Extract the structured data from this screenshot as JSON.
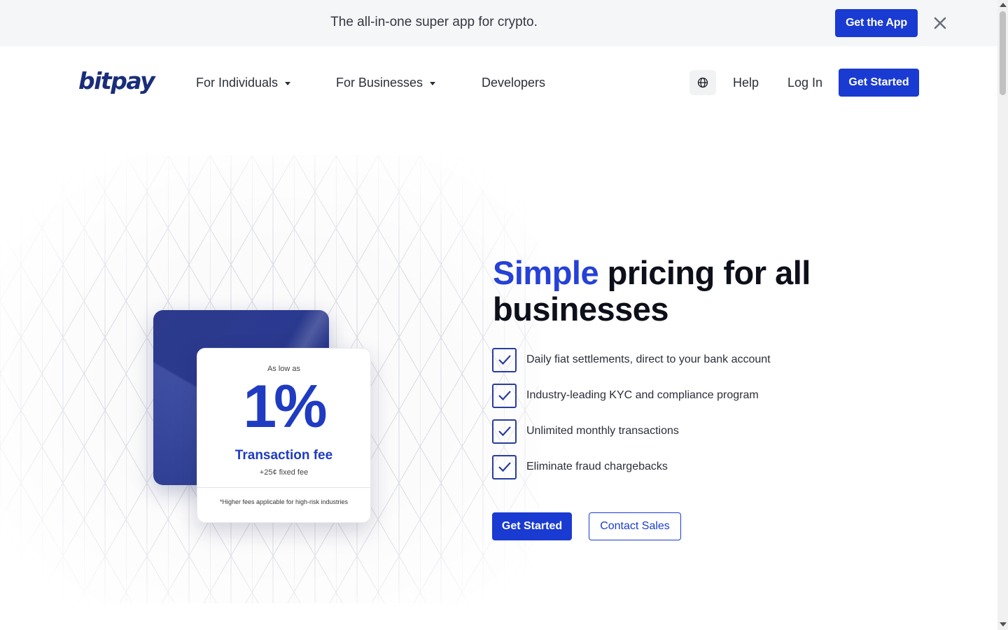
{
  "promo": {
    "text": "The all-in-one super app for crypto.",
    "cta_label": "Get the App",
    "close_icon": "close-icon"
  },
  "nav": {
    "logo": "bitpay",
    "items": [
      {
        "label": "For Individuals",
        "has_dropdown": true
      },
      {
        "label": "For Businesses",
        "has_dropdown": true
      },
      {
        "label": "Developers",
        "has_dropdown": false
      }
    ],
    "language_icon": "globe-icon",
    "help_label": "Help",
    "login_label": "Log In",
    "cta_label": "Get Started"
  },
  "hero": {
    "title_accent": "Simple",
    "title_rest": " pricing for all businesses",
    "card": {
      "eyebrow": "As low as",
      "rate": "1%",
      "title": "Transaction fee",
      "subtitle": "+25¢ fixed fee",
      "note": "*Higher fees applicable for high-risk industries"
    },
    "features": [
      "Daily fiat settlements, direct to your bank account",
      "Industry-leading KYC and compliance program",
      "Unlimited monthly transactions",
      "Eliminate fraud chargebacks"
    ],
    "primary_cta": "Get Started",
    "secondary_cta": "Contact Sales"
  },
  "colors": {
    "brand_blue": "#1a3bd1",
    "accent_blue": "#2541d6",
    "logo_navy": "#1a2d7a",
    "banner_bg": "#f5f6f8"
  }
}
